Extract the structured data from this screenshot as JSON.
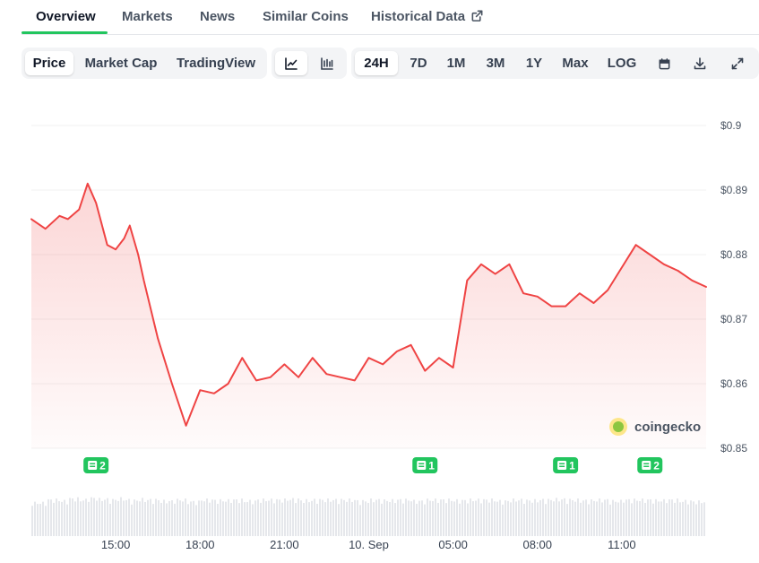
{
  "tabs": {
    "overview": "Overview",
    "markets": "Markets",
    "news": "News",
    "similar": "Similar Coins",
    "historical": "Historical Data"
  },
  "chart_type_buttons": {
    "price": "Price",
    "market_cap": "Market Cap",
    "tradingview": "TradingView"
  },
  "view_buttons": {
    "line": "line-chart-icon",
    "candle": "candlestick-icon"
  },
  "range_buttons": {
    "d24": "24H",
    "d7": "7D",
    "m1": "1M",
    "m3": "3M",
    "y1": "1Y",
    "max": "Max",
    "log": "LOG"
  },
  "tool_icons": {
    "calendar": "calendar-icon",
    "download": "download-icon",
    "fullscreen": "expand-icon"
  },
  "watermark": {
    "text": "coingecko"
  },
  "colors": {
    "line": "#ef4444",
    "accent": "#22c55e",
    "volume": "#e5e7eb",
    "grid": "#f1f1f1"
  },
  "chart_data": {
    "type": "area",
    "y_ticks": [
      "$0.9",
      "$0.89",
      "$0.88",
      "$0.87",
      "$0.86",
      "$0.85"
    ],
    "ylim": [
      0.85,
      0.9
    ],
    "x_tick_labels": [
      "15:00",
      "18:00",
      "21:00",
      "10. Sep",
      "05:00",
      "08:00",
      "11:00"
    ],
    "news_markers": [
      {
        "label": "2",
        "hour": 2.3
      },
      {
        "label": "1",
        "hour": 14.0
      },
      {
        "label": "1",
        "hour": 19.0
      },
      {
        "label": "2",
        "hour": 22.0
      }
    ],
    "series": [
      {
        "hour": [
          0,
          0.5,
          1.0,
          1.3,
          1.7,
          2.0,
          2.3,
          2.7,
          3.0,
          3.3,
          3.5,
          3.8,
          4.0,
          4.5,
          5.0,
          5.5,
          6.0,
          6.5,
          7.0,
          7.5,
          8.0,
          8.5,
          9.0,
          9.5,
          10.0,
          10.5,
          11.0,
          11.5,
          12.0,
          12.5,
          13.0,
          13.5,
          14.0,
          14.5,
          15.0,
          15.5,
          16.0,
          16.5,
          17.0,
          17.5,
          18.0,
          18.5,
          19.0,
          19.5,
          20.0,
          20.5,
          21.0,
          21.5,
          22.0,
          22.5,
          23.0,
          23.5,
          24.0
        ],
        "price": [
          0.8855,
          0.884,
          0.886,
          0.8855,
          0.887,
          0.891,
          0.888,
          0.8815,
          0.8808,
          0.8825,
          0.8845,
          0.88,
          0.876,
          0.867,
          0.86,
          0.8535,
          0.859,
          0.8585,
          0.86,
          0.864,
          0.8605,
          0.861,
          0.863,
          0.861,
          0.864,
          0.8615,
          0.861,
          0.8605,
          0.864,
          0.863,
          0.865,
          0.866,
          0.862,
          0.864,
          0.8625,
          0.876,
          0.8785,
          0.877,
          0.8785,
          0.874,
          0.8735,
          0.872,
          0.872,
          0.874,
          0.8725,
          0.8745,
          0.878,
          0.8815,
          0.88,
          0.8785,
          0.8775,
          0.876,
          0.875
        ],
        "volume": [
          0.55,
          0.6,
          0.58,
          0.62,
          0.6,
          0.63,
          0.61,
          0.6,
          0.62,
          0.6,
          0.59,
          0.61,
          0.6,
          0.58,
          0.6,
          0.57,
          0.6,
          0.59,
          0.6,
          0.58,
          0.6,
          0.6,
          0.61,
          0.59,
          0.6,
          0.6,
          0.6,
          0.58,
          0.6,
          0.59,
          0.6,
          0.58,
          0.6,
          0.6,
          0.59,
          0.6,
          0.6,
          0.58,
          0.6,
          0.59,
          0.6,
          0.61,
          0.6,
          0.59,
          0.6,
          0.58,
          0.6,
          0.6,
          0.59,
          0.6,
          0.58,
          0.57,
          0.56
        ]
      }
    ]
  }
}
